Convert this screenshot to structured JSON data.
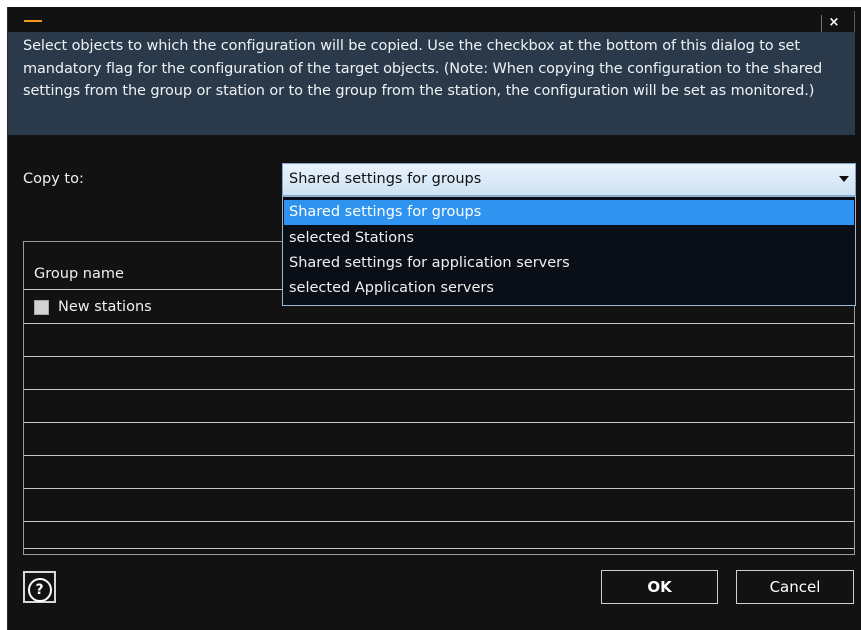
{
  "dialog": {
    "close_label": "×",
    "description": "Select objects to which the configuration will be copied. Use the checkbox at the bottom of this dialog to set mandatory flag for the configuration of the target objects. (Note: When copying the configuration to the shared settings from the group or station or to the group from the station, the configuration will be set as monitored.)",
    "accent_color": "#f39a1e",
    "highlight_color": "#2f93f0"
  },
  "copy_to": {
    "label": "Copy to:",
    "selected": "Shared settings for groups",
    "options": [
      "Shared settings for groups",
      "selected Stations",
      "Shared settings for application servers",
      "selected Application servers"
    ]
  },
  "group_table": {
    "header": "Group name",
    "rows": [
      {
        "label": "New stations",
        "checked": false
      }
    ]
  },
  "footer": {
    "help_label": "?",
    "ok_label": "OK",
    "cancel_label": "Cancel"
  }
}
